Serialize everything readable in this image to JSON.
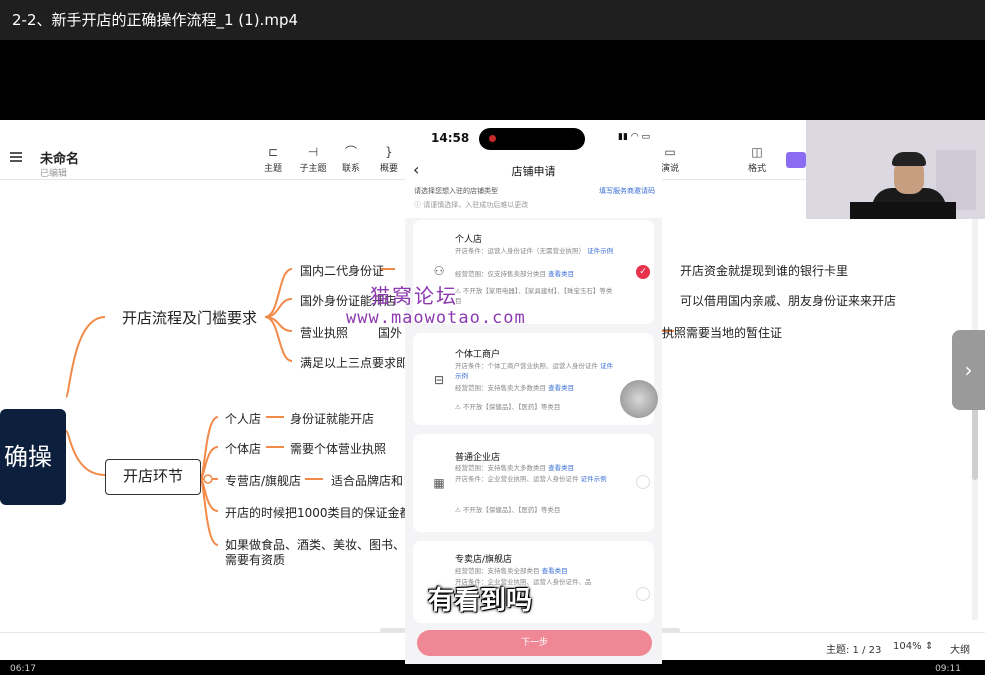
{
  "player": {
    "title": "2-2、新手开店的正确操作流程_1 (1).mp4"
  },
  "app": {
    "doc_title": "未命名",
    "doc_status": "已编辑",
    "tools": [
      {
        "icon": "topic-icon",
        "label": "主题"
      },
      {
        "icon": "subtopic-icon",
        "label": "子主题"
      },
      {
        "icon": "relation-icon",
        "label": "联系"
      },
      {
        "icon": "summary-icon",
        "label": "概要"
      },
      {
        "icon": "presentation-icon",
        "label": "演说"
      },
      {
        "icon": "format-icon",
        "label": "格式"
      }
    ],
    "status": {
      "topic_count": "主题: 1 / 23",
      "zoom": "104%",
      "outline": "大纲"
    }
  },
  "mindmap": {
    "root_text": "确操",
    "branch1": "开店流程及门槛要求",
    "branch1_items": [
      "国内二代身份证",
      "国外身份证能开店",
      "营业执照",
      "满足以上三点要求即"
    ],
    "branch1_item3_suffix": "国外",
    "right_notes": [
      "开店资金就提现到谁的银行卡里",
      "可以借用国内亲戚、朋友身份证来来开店",
      "执照需要当地的暂住证"
    ],
    "branch2": "开店环节",
    "branch2_items": [
      "个人店",
      "个体店",
      "专营店/旗舰店",
      "开店的时候把1000类目的保证金都",
      "如果做食品、酒类、美妆、图书、"
    ],
    "branch2_item5_line2": "需要有资质",
    "branch2_details": [
      "身份证就能开店",
      "需要个体营业执照",
      "适合品牌店和自"
    ]
  },
  "phone": {
    "time": "14:58",
    "nav_title": "店铺申请",
    "hint": "请选择您想入驻的店铺类型",
    "hint_link": "填写服务商邀请码",
    "hint_sub": "请谨慎选择，入驻成功后难以更改",
    "cards": [
      {
        "name": "个人店",
        "line1": "开店条件：运营人身份证件（无需营业执照）",
        "line1_link": "证件示例",
        "line2": "经营范围：仅支持售卖部分类目",
        "line2_link": "查看类目",
        "line3": "不开放【家用电器】、【家具建材】、【珠宝玉石】等类目",
        "checked": true
      },
      {
        "name": "个体工商户",
        "line1": "开店条件：个体工商户营业执照、运营人身份证件",
        "line1_link": "证件示例",
        "line2": "经营范围：支持售卖大多数类目",
        "line2_link": "查看类目",
        "line3": "不开放【保健品】、【医药】等类目",
        "checked": false
      },
      {
        "name": "普通企业店",
        "line1": "经营范围：支持售卖大多数类目",
        "line1_link": "查看类目",
        "line2": "开店条件：企业营业执照、运营人身份证件",
        "line2_link": "证件示例",
        "line3": "不开放【保健品】、【医药】等类目",
        "checked": false
      },
      {
        "name": "专卖店/旗舰店",
        "line1": "经营范围：支持售卖全部类目",
        "line1_link": "查看类目",
        "line2": "开店条件：企业营业执照、运营人身份证件、品",
        "line2_link": "",
        "line3": "",
        "checked": false
      }
    ],
    "next_button": "下一步",
    "subtitle": "有看到吗"
  },
  "watermark": {
    "line1": "猫窝论坛",
    "line2": "www.maowotao.com"
  },
  "timeline": {
    "elapsed": "06:17",
    "total": "09:11"
  }
}
